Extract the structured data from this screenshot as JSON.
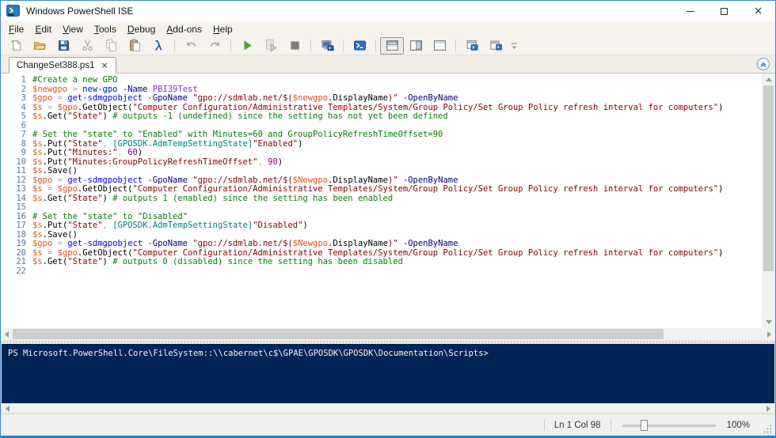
{
  "window": {
    "title": "Windows PowerShell ISE",
    "icon": "powershell-ise-icon",
    "close_glyph": "×",
    "controls": [
      "minimize",
      "maximize",
      "close"
    ]
  },
  "menu": {
    "items": [
      "File",
      "Edit",
      "View",
      "Tools",
      "Debug",
      "Add-ons",
      "Help"
    ]
  },
  "toolbar": {
    "buttons": [
      {
        "icon": "new-script-icon",
        "label": "New Script"
      },
      {
        "icon": "open-script-icon",
        "label": "Open Script"
      },
      {
        "icon": "save-icon",
        "label": "Save"
      },
      {
        "icon": "cut-icon",
        "label": "Cut",
        "disabled": true
      },
      {
        "icon": "copy-icon",
        "label": "Copy",
        "disabled": true
      },
      {
        "icon": "paste-icon",
        "label": "Paste"
      },
      {
        "icon": "clear-console-icon",
        "label": "Clear Console Pane"
      },
      {
        "sep": true
      },
      {
        "icon": "undo-icon",
        "label": "Undo",
        "disabled": true
      },
      {
        "icon": "redo-icon",
        "label": "Redo",
        "disabled": true
      },
      {
        "sep": true
      },
      {
        "icon": "run-script-icon",
        "label": "Run Script"
      },
      {
        "icon": "run-selection-icon",
        "label": "Run Selection",
        "disabled": true
      },
      {
        "icon": "stop-operation-icon",
        "label": "Stop Operation",
        "disabled": true
      },
      {
        "sep": true
      },
      {
        "icon": "new-remote-powershell-tab-icon",
        "label": "New Remote PowerShell Tab"
      },
      {
        "sep": true
      },
      {
        "icon": "start-powershell-icon",
        "label": "Start PowerShell exe"
      },
      {
        "sep": true
      },
      {
        "icon": "show-script-pane-top-icon",
        "label": "Show Script Pane Top",
        "selected": true
      },
      {
        "icon": "show-script-pane-right-icon",
        "label": "Show Script Pane Right"
      },
      {
        "icon": "show-script-pane-maximized-icon",
        "label": "Show Script Pane Maximized"
      },
      {
        "sep": true
      },
      {
        "icon": "new-powershell-tab-icon",
        "label": "New PowerShell Tab"
      },
      {
        "icon": "show-command-window-icon",
        "label": "Show Command Window"
      },
      {
        "icon": "toolbar-overflow-icon",
        "label": "Toolbar Options",
        "small": true
      }
    ]
  },
  "tabs": {
    "items": [
      {
        "label": "ChangeSet388.ps1",
        "active": true
      }
    ],
    "close_glyph": "×",
    "collapse_button_icon": "chevron-up-icon"
  },
  "editor": {
    "language": "powershell",
    "line_number_color": "#5a7894",
    "token_colors": {
      "comment": "#0b7c0b",
      "variable": "#e8511d",
      "command": "#0000ff",
      "parameter": "#000080",
      "argument": "#8a2be2",
      "string": "#8b0000",
      "number": "#800080",
      "type": "#008080",
      "operator": "#a9a9a9",
      "plain": "#000000"
    },
    "lines": [
      [
        [
          "cm",
          "#Create a new GPO"
        ]
      ],
      [
        [
          "v",
          "$newgpo"
        ],
        [
          "o",
          " = "
        ],
        [
          "c",
          "new-gpo"
        ],
        [
          "k",
          " "
        ],
        [
          "p",
          "-Name"
        ],
        [
          "k",
          " "
        ],
        [
          "a",
          "PBI39Test"
        ]
      ],
      [
        [
          "v",
          "$gpo"
        ],
        [
          "o",
          " = "
        ],
        [
          "c",
          "get-sdmgpobject"
        ],
        [
          "k",
          " "
        ],
        [
          "p",
          "-GpoName"
        ],
        [
          "k",
          " "
        ],
        [
          "s",
          "\"gpo://sdmlab.net/$("
        ],
        [
          "v",
          "$newgpo"
        ],
        [
          "k",
          ".DisplayName"
        ],
        [
          "s",
          ")\""
        ],
        [
          "k",
          " "
        ],
        [
          "p",
          "-OpenByName"
        ]
      ],
      [
        [
          "v",
          "$s"
        ],
        [
          "o",
          " = "
        ],
        [
          "v",
          "$gpo"
        ],
        [
          "k",
          ".GetObject("
        ],
        [
          "s",
          "\"Computer Configuration/Administrative Templates/System/Group Policy/Set Group Policy refresh interval for computers\""
        ],
        [
          "k",
          ")"
        ]
      ],
      [
        [
          "v",
          "$s"
        ],
        [
          "k",
          ".Get("
        ],
        [
          "s",
          "\"State\""
        ],
        [
          "k",
          ") "
        ],
        [
          "cm",
          "# outputs -1 (undefined) since the setting has not yet been defined"
        ]
      ],
      [],
      [
        [
          "cm",
          "# Set the \"state\" to \"Enabled\" with Minutes=60 and GroupPolicyRefreshTimeOffset=90"
        ]
      ],
      [
        [
          "v",
          "$s"
        ],
        [
          "k",
          ".Put("
        ],
        [
          "s",
          "\"State\""
        ],
        [
          "o",
          ", "
        ],
        [
          "t",
          "[GPOSDK.AdmTempSettingState]"
        ],
        [
          "s",
          "\"Enabled\""
        ],
        [
          "k",
          ")"
        ]
      ],
      [
        [
          "v",
          "$s"
        ],
        [
          "k",
          ".Put("
        ],
        [
          "s",
          "\"Minutes:\""
        ],
        [
          "o",
          ", "
        ],
        [
          "n",
          "60"
        ],
        [
          "k",
          ")"
        ]
      ],
      [
        [
          "v",
          "$s"
        ],
        [
          "k",
          ".Put("
        ],
        [
          "s",
          "\"Minutes:GroupPolicyRefreshTimeOffset\""
        ],
        [
          "o",
          ", "
        ],
        [
          "n",
          "90"
        ],
        [
          "k",
          ")"
        ]
      ],
      [
        [
          "v",
          "$s"
        ],
        [
          "k",
          ".Save()"
        ]
      ],
      [
        [
          "v",
          "$gpo"
        ],
        [
          "o",
          " = "
        ],
        [
          "c",
          "get-sdmgpobject"
        ],
        [
          "k",
          " "
        ],
        [
          "p",
          "-GpoName"
        ],
        [
          "k",
          " "
        ],
        [
          "s",
          "\"gpo://sdmlab.net/$("
        ],
        [
          "v",
          "$Newgpo"
        ],
        [
          "k",
          ".DisplayName"
        ],
        [
          "s",
          ")\""
        ],
        [
          "k",
          " "
        ],
        [
          "p",
          "-OpenByName"
        ]
      ],
      [
        [
          "v",
          "$s"
        ],
        [
          "o",
          " = "
        ],
        [
          "v",
          "$gpo"
        ],
        [
          "k",
          ".GetObject("
        ],
        [
          "s",
          "\"Computer Configuration/Administrative Templates/System/Group Policy/Set Group Policy refresh interval for computers\""
        ],
        [
          "k",
          ")"
        ]
      ],
      [
        [
          "v",
          "$s"
        ],
        [
          "k",
          ".Get("
        ],
        [
          "s",
          "\"State\""
        ],
        [
          "k",
          ") "
        ],
        [
          "cm",
          "# outputs 1 (enabled) since the setting has been enabled"
        ]
      ],
      [],
      [
        [
          "cm",
          "# Set the \"state\" to \"Disabled\""
        ]
      ],
      [
        [
          "v",
          "$s"
        ],
        [
          "k",
          ".Put("
        ],
        [
          "s",
          "\"State\""
        ],
        [
          "o",
          ", "
        ],
        [
          "t",
          "[GPOSDK.AdmTempSettingState]"
        ],
        [
          "s",
          "\"Disabled\""
        ],
        [
          "k",
          ")"
        ]
      ],
      [
        [
          "v",
          "$s"
        ],
        [
          "k",
          ".Save()"
        ]
      ],
      [
        [
          "v",
          "$gpo"
        ],
        [
          "o",
          " = "
        ],
        [
          "c",
          "get-sdmgpobject"
        ],
        [
          "k",
          " "
        ],
        [
          "p",
          "-GpoName"
        ],
        [
          "k",
          " "
        ],
        [
          "s",
          "\"gpo://sdmlab.net/$("
        ],
        [
          "v",
          "$Newgpo"
        ],
        [
          "k",
          ".DisplayName"
        ],
        [
          "s",
          ")\""
        ],
        [
          "k",
          " "
        ],
        [
          "p",
          "-OpenByName"
        ]
      ],
      [
        [
          "v",
          "$s"
        ],
        [
          "o",
          " = "
        ],
        [
          "v",
          "$gpo"
        ],
        [
          "k",
          ".GetObject("
        ],
        [
          "s",
          "\"Computer Configuration/Administrative Templates/System/Group Policy/Set Group Policy refresh interval for computers\""
        ],
        [
          "k",
          ")"
        ]
      ],
      [
        [
          "v",
          "$s"
        ],
        [
          "k",
          ".Get("
        ],
        [
          "s",
          "\"State\""
        ],
        [
          "k",
          ") "
        ],
        [
          "cm",
          "# outputs 0 (disabled) since the setting has been disabled"
        ]
      ],
      []
    ]
  },
  "console": {
    "background": "#012456",
    "prompt": "PS Microsoft.PowerShell.Core\\FileSystem::\\\\cabernet\\c$\\GPAE\\GPOSDK\\GPOSDK\\Documentation\\Scripts>"
  },
  "statusbar": {
    "cursor_position": "Ln 1 Col 98",
    "zoom_label": "100%",
    "zoom_slider_percent": 20
  }
}
